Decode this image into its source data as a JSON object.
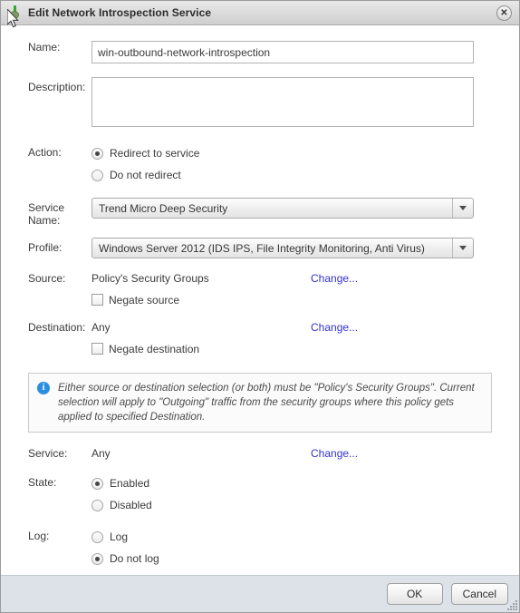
{
  "window": {
    "title": "Edit Network Introspection Service",
    "icon": "network-introspection-icon",
    "close_label": "✕"
  },
  "form": {
    "name": {
      "label": "Name:",
      "value": "win-outbound-network-introspection",
      "placeholder": ""
    },
    "description": {
      "label": "Description:",
      "value": "",
      "placeholder": ""
    },
    "action": {
      "label": "Action:",
      "options": [
        {
          "label": "Redirect to service",
          "selected": true
        },
        {
          "label": "Do not redirect",
          "selected": false
        }
      ]
    },
    "service_name": {
      "label": "Service Name:",
      "value": "Trend Micro Deep Security"
    },
    "profile": {
      "label": "Profile:",
      "value": "Windows Server 2012 (IDS IPS, File Integrity Monitoring, Anti Virus)"
    },
    "source": {
      "label": "Source:",
      "value": "Policy's Security Groups",
      "change_label": "Change...",
      "negate_label": "Negate source",
      "negate_checked": false
    },
    "destination": {
      "label": "Destination:",
      "value": "Any",
      "change_label": "Change...",
      "negate_label": "Negate destination",
      "negate_checked": false
    },
    "info": {
      "icon": "info-icon",
      "text": "Either source or destination selection (or both) must be \"Policy's Security Groups\". Current selection will apply to \"Outgoing\" traffic from the security groups where this policy gets applied to specified Destination."
    },
    "service": {
      "label": "Service:",
      "value": "Any",
      "change_label": "Change..."
    },
    "state": {
      "label": "State:",
      "options": [
        {
          "label": "Enabled",
          "selected": true
        },
        {
          "label": "Disabled",
          "selected": false
        }
      ]
    },
    "log": {
      "label": "Log:",
      "options": [
        {
          "label": "Log",
          "selected": false
        },
        {
          "label": "Do not log",
          "selected": true
        }
      ]
    }
  },
  "footer": {
    "ok_label": "OK",
    "cancel_label": "Cancel"
  },
  "colors": {
    "link": "#3333cc",
    "info_accent": "#2a8fe0",
    "footer_bg": "#dde1e8"
  }
}
